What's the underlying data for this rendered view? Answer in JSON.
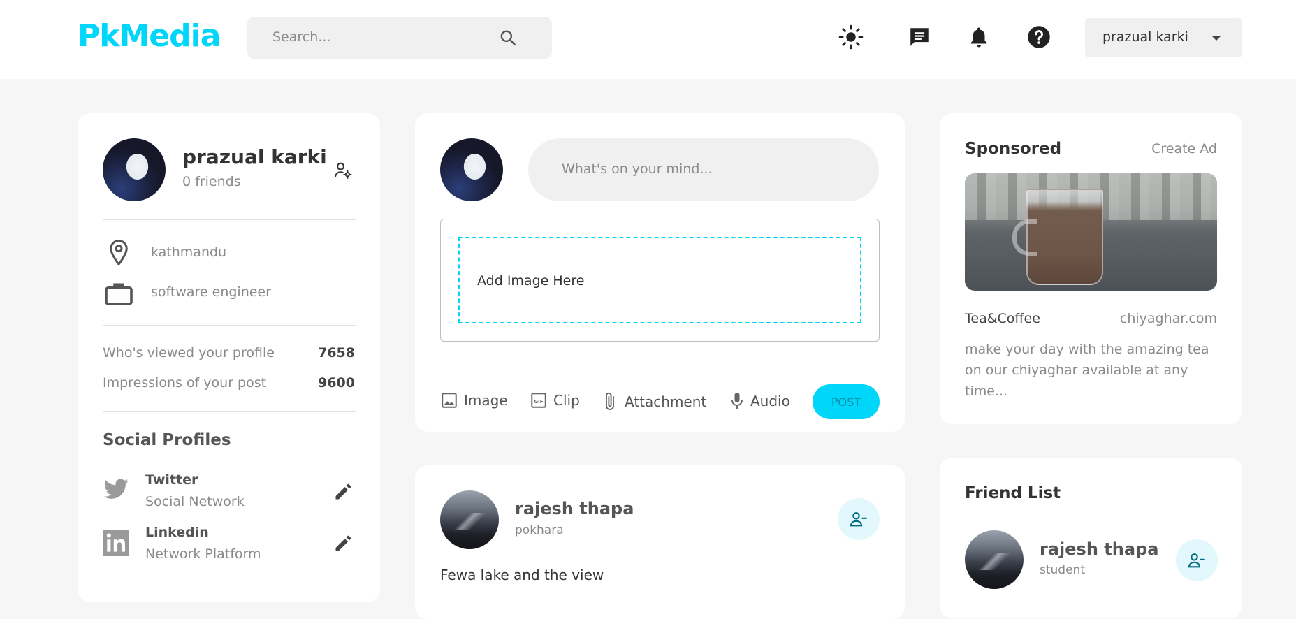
{
  "navbar": {
    "logo": "PkMedia",
    "search_placeholder": "Search...",
    "icons": [
      "sun-icon",
      "message-icon",
      "bell-icon",
      "help-icon"
    ],
    "user_name": "prazual karki"
  },
  "profile": {
    "name": "prazual karki",
    "friends": "0 friends",
    "location": "kathmandu",
    "occupation": "software engineer",
    "stats": [
      {
        "label": "Who's viewed your profile",
        "value": "7658"
      },
      {
        "label": "Impressions of your post",
        "value": "9600"
      }
    ],
    "social_title": "Social Profiles",
    "socials": [
      {
        "name": "Twitter",
        "type": "Social Network"
      },
      {
        "name": "Linkedin",
        "type": "Network Platform"
      }
    ]
  },
  "create_post": {
    "placeholder": "What's on your mind...",
    "dropzone": "Add Image Here",
    "actions": [
      "Image",
      "Clip",
      "Attachment",
      "Audio"
    ],
    "post_button": "POST"
  },
  "post": {
    "author": "rajesh thapa",
    "location": "pokhara",
    "text": "Fewa lake and the view"
  },
  "sponsored": {
    "title": "Sponsored",
    "create_ad": "Create Ad",
    "brand": "Tea&Coffee",
    "site": "chiyaghar.com",
    "description": "make your day with the amazing tea on our chiyaghar available at any time..."
  },
  "friend_list": {
    "title": "Friend List",
    "friends": [
      {
        "name": "rajesh thapa",
        "role": "student"
      }
    ]
  },
  "colors": {
    "accent": "#00d5fa",
    "background": "#f6f6f6",
    "input_bg": "#f0f0f0"
  }
}
